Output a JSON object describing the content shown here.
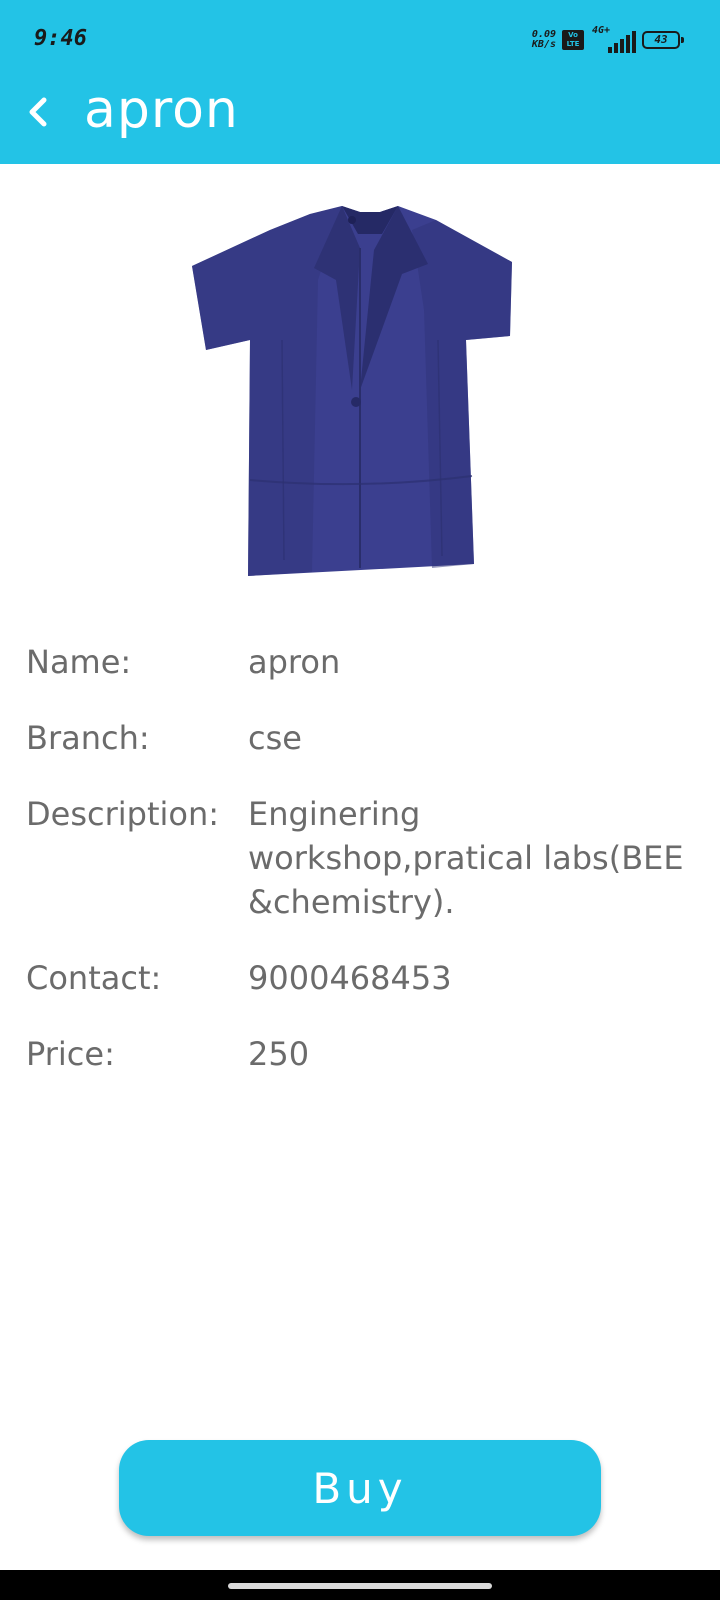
{
  "status_bar": {
    "time": "9:46",
    "net_speed_value": "0.09",
    "net_speed_unit": "KB/s",
    "volte_top": "Vo",
    "volte_bottom": "LTE",
    "network_type": "4G+",
    "battery": "43"
  },
  "app_bar": {
    "back_icon": "chevron-left-icon",
    "title": "apron"
  },
  "product": {
    "image_icon": "apron-image",
    "fields": [
      {
        "label": "Name:",
        "value": "apron"
      },
      {
        "label": "Branch:",
        "value": "cse"
      },
      {
        "label": "Description:",
        "value": "Enginering workshop,pratical labs(BEE &chemistry)."
      },
      {
        "label": "Contact:",
        "value": "9000468453"
      },
      {
        "label": "Price:",
        "value": "250"
      }
    ]
  },
  "actions": {
    "buy_label": "Buy"
  },
  "colors": {
    "accent": "#23c3e6",
    "text_secondary": "#6b6b6b",
    "apron": "#3b3f8f"
  }
}
